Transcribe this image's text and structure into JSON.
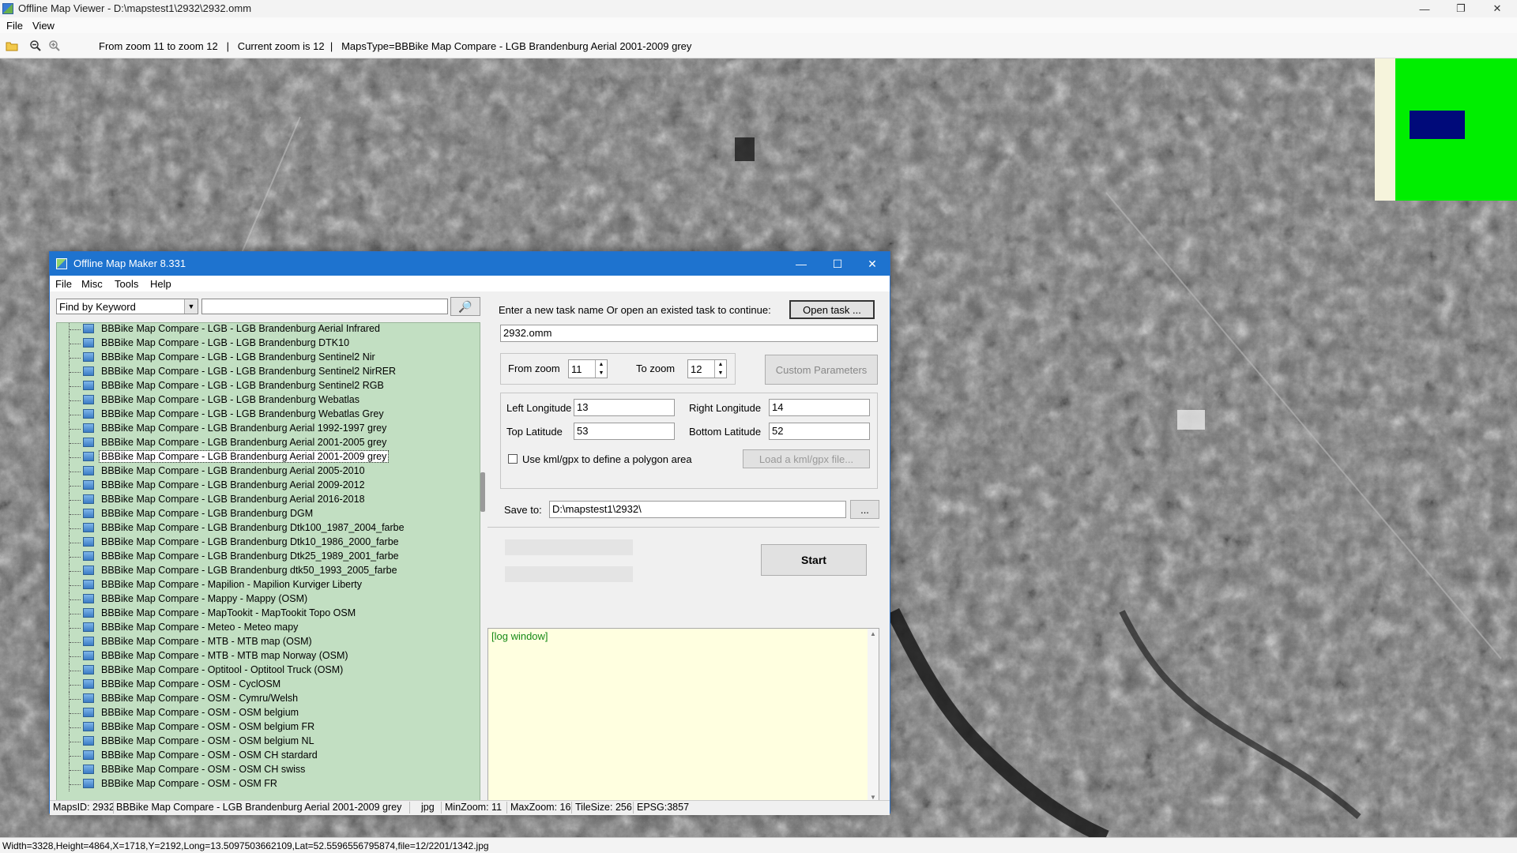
{
  "viewer": {
    "title": "Offline Map Viewer - D:\\mapstest1\\2932\\2932.omm",
    "menu": [
      "File",
      "View"
    ],
    "toolbar_info": "From zoom 11 to zoom 12   |   Current zoom is 12  |   MapsType=BBBike Map Compare - LGB Brandenburg Aerial 2001-2009 grey",
    "status": "Width=3328,Height=4864,X=1718,Y=2192,Long=13.5097503662109,Lat=52.5596556795874,file=12/2201/1342.jpg",
    "window_controls": {
      "minimize": "—",
      "maximize": "❐",
      "close": "✕"
    },
    "minimap_colors": {
      "background": "#f6f4dc",
      "area": "#00ee00",
      "viewport": "#000a7a"
    }
  },
  "dialog": {
    "title": "Offline Map Maker 8.331",
    "menu": [
      "File",
      "Misc",
      "Tools",
      "Help"
    ],
    "keyword_select": "Find by Keyword",
    "keyword_input": "",
    "search_icon": "🔎",
    "maps": [
      "BBBike Map Compare - LGB - LGB Brandenburg Aerial Infrared",
      "BBBike Map Compare - LGB - LGB Brandenburg DTK10",
      "BBBike Map Compare - LGB - LGB Brandenburg Sentinel2 Nir",
      "BBBike Map Compare - LGB - LGB Brandenburg Sentinel2 NirRER",
      "BBBike Map Compare - LGB - LGB Brandenburg Sentinel2 RGB",
      "BBBike Map Compare - LGB - LGB Brandenburg Webatlas",
      "BBBike Map Compare - LGB - LGB Brandenburg Webatlas Grey",
      "BBBike Map Compare - LGB Brandenburg Aerial 1992-1997 grey",
      "BBBike Map Compare - LGB Brandenburg Aerial 2001-2005 grey",
      "BBBike Map Compare - LGB Brandenburg Aerial 2001-2009 grey",
      "BBBike Map Compare - LGB Brandenburg Aerial 2005-2010",
      "BBBike Map Compare - LGB Brandenburg Aerial 2009-2012",
      "BBBike Map Compare - LGB Brandenburg Aerial 2016-2018",
      "BBBike Map Compare - LGB Brandenburg DGM",
      "BBBike Map Compare - LGB Brandenburg Dtk100_1987_2004_farbe",
      "BBBike Map Compare - LGB Brandenburg Dtk10_1986_2000_farbe",
      "BBBike Map Compare - LGB Brandenburg Dtk25_1989_2001_farbe",
      "BBBike Map Compare - LGB Brandenburg dtk50_1993_2005_farbe",
      "BBBike Map Compare - Mapilion - Mapilion Kurviger Liberty",
      "BBBike Map Compare - Mappy - Mappy (OSM)",
      "BBBike Map Compare - MapTookit - MapTookit Topo OSM",
      "BBBike Map Compare - Meteo - Meteo mapy",
      "BBBike Map Compare - MTB - MTB map (OSM)",
      "BBBike Map Compare - MTB - MTB map Norway (OSM)",
      "BBBike Map Compare - Optitool - Optitool Truck (OSM)",
      "BBBike Map Compare - OSM - CyclOSM",
      "BBBike Map Compare - OSM - Cymru/Welsh",
      "BBBike Map Compare - OSM - OSM belgium",
      "BBBike Map Compare - OSM - OSM belgium FR",
      "BBBike Map Compare - OSM - OSM belgium NL",
      "BBBike Map Compare - OSM - OSM CH stardard",
      "BBBike Map Compare - OSM - OSM CH swiss",
      "BBBike Map Compare - OSM - OSM FR"
    ],
    "selected_index": 9,
    "task_prompt": "Enter a new task name Or open an existed task to continue:",
    "open_task": "Open task ...",
    "task_name": "2932.omm",
    "from_zoom_label": "From zoom",
    "from_zoom": "11",
    "to_zoom_label": "To zoom",
    "to_zoom": "12",
    "custom_params": "Custom Parameters",
    "left_lon_label": "Left Longitude",
    "left_lon": "13",
    "right_lon_label": "Right Longitude",
    "right_lon": "14",
    "top_lat_label": "Top Latitude",
    "top_lat": "53",
    "bottom_lat_label": "Bottom Latitude",
    "bottom_lat": "52",
    "kml_checkbox": "Use kml/gpx to define a polygon area",
    "kml_checked": false,
    "load_kml": "Load a kml/gpx file...",
    "save_to_label": "Save to:",
    "save_to": "D:\\mapstest1\\2932\\",
    "browse": "...",
    "start": "Start",
    "log": "[log window]",
    "status": {
      "maps_id": "MapsID: 2932",
      "map_name": "BBBike Map Compare - LGB Brandenburg Aerial 2001-2009 grey",
      "format": "jpg",
      "min_zoom": "MinZoom: 11",
      "max_zoom": "MaxZoom: 16",
      "tile_size": "TileSize: 256",
      "epsg": "EPSG:3857"
    }
  }
}
